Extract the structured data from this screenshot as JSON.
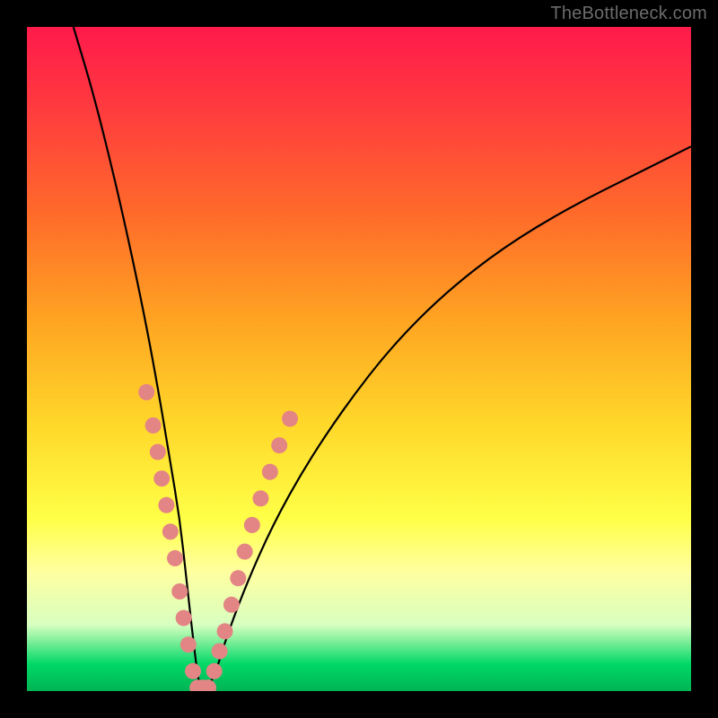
{
  "watermark": "TheBottleneck.com",
  "chart_data": {
    "type": "line",
    "title": "",
    "xlabel": "",
    "ylabel": "",
    "xlim": [
      0,
      100
    ],
    "ylim": [
      0,
      100
    ],
    "series": [
      {
        "name": "bottleneck-curve",
        "x": [
          7,
          10,
          13,
          15.5,
          18,
          20,
          21.5,
          23,
          24,
          25,
          26,
          27,
          28.5,
          30,
          33,
          37,
          42,
          48,
          55,
          63,
          72,
          82,
          92,
          100
        ],
        "values": [
          100,
          90,
          78,
          67,
          55,
          44,
          35,
          26,
          17,
          8,
          0,
          0,
          3,
          8,
          16,
          25,
          34,
          43,
          52,
          60,
          67,
          73,
          78,
          82
        ]
      }
    ],
    "markers": {
      "left_branch": [
        {
          "x": 18,
          "y": 45
        },
        {
          "x": 19,
          "y": 40
        },
        {
          "x": 19.7,
          "y": 36
        },
        {
          "x": 20.3,
          "y": 32
        },
        {
          "x": 21,
          "y": 28
        },
        {
          "x": 21.6,
          "y": 24
        },
        {
          "x": 22.3,
          "y": 20
        },
        {
          "x": 23,
          "y": 15
        },
        {
          "x": 23.6,
          "y": 11
        },
        {
          "x": 24.3,
          "y": 7
        },
        {
          "x": 25,
          "y": 3
        }
      ],
      "bottom": [
        {
          "x": 25.7,
          "y": 0.5
        },
        {
          "x": 26.5,
          "y": 0.5
        },
        {
          "x": 27.3,
          "y": 0.5
        }
      ],
      "right_branch": [
        {
          "x": 28.2,
          "y": 3
        },
        {
          "x": 29,
          "y": 6
        },
        {
          "x": 29.8,
          "y": 9
        },
        {
          "x": 30.8,
          "y": 13
        },
        {
          "x": 31.8,
          "y": 17
        },
        {
          "x": 32.8,
          "y": 21
        },
        {
          "x": 33.9,
          "y": 25
        },
        {
          "x": 35.2,
          "y": 29
        },
        {
          "x": 36.6,
          "y": 33
        },
        {
          "x": 38,
          "y": 37
        },
        {
          "x": 39.6,
          "y": 41
        }
      ]
    },
    "marker_color": "#e48585",
    "marker_radius": 9
  }
}
